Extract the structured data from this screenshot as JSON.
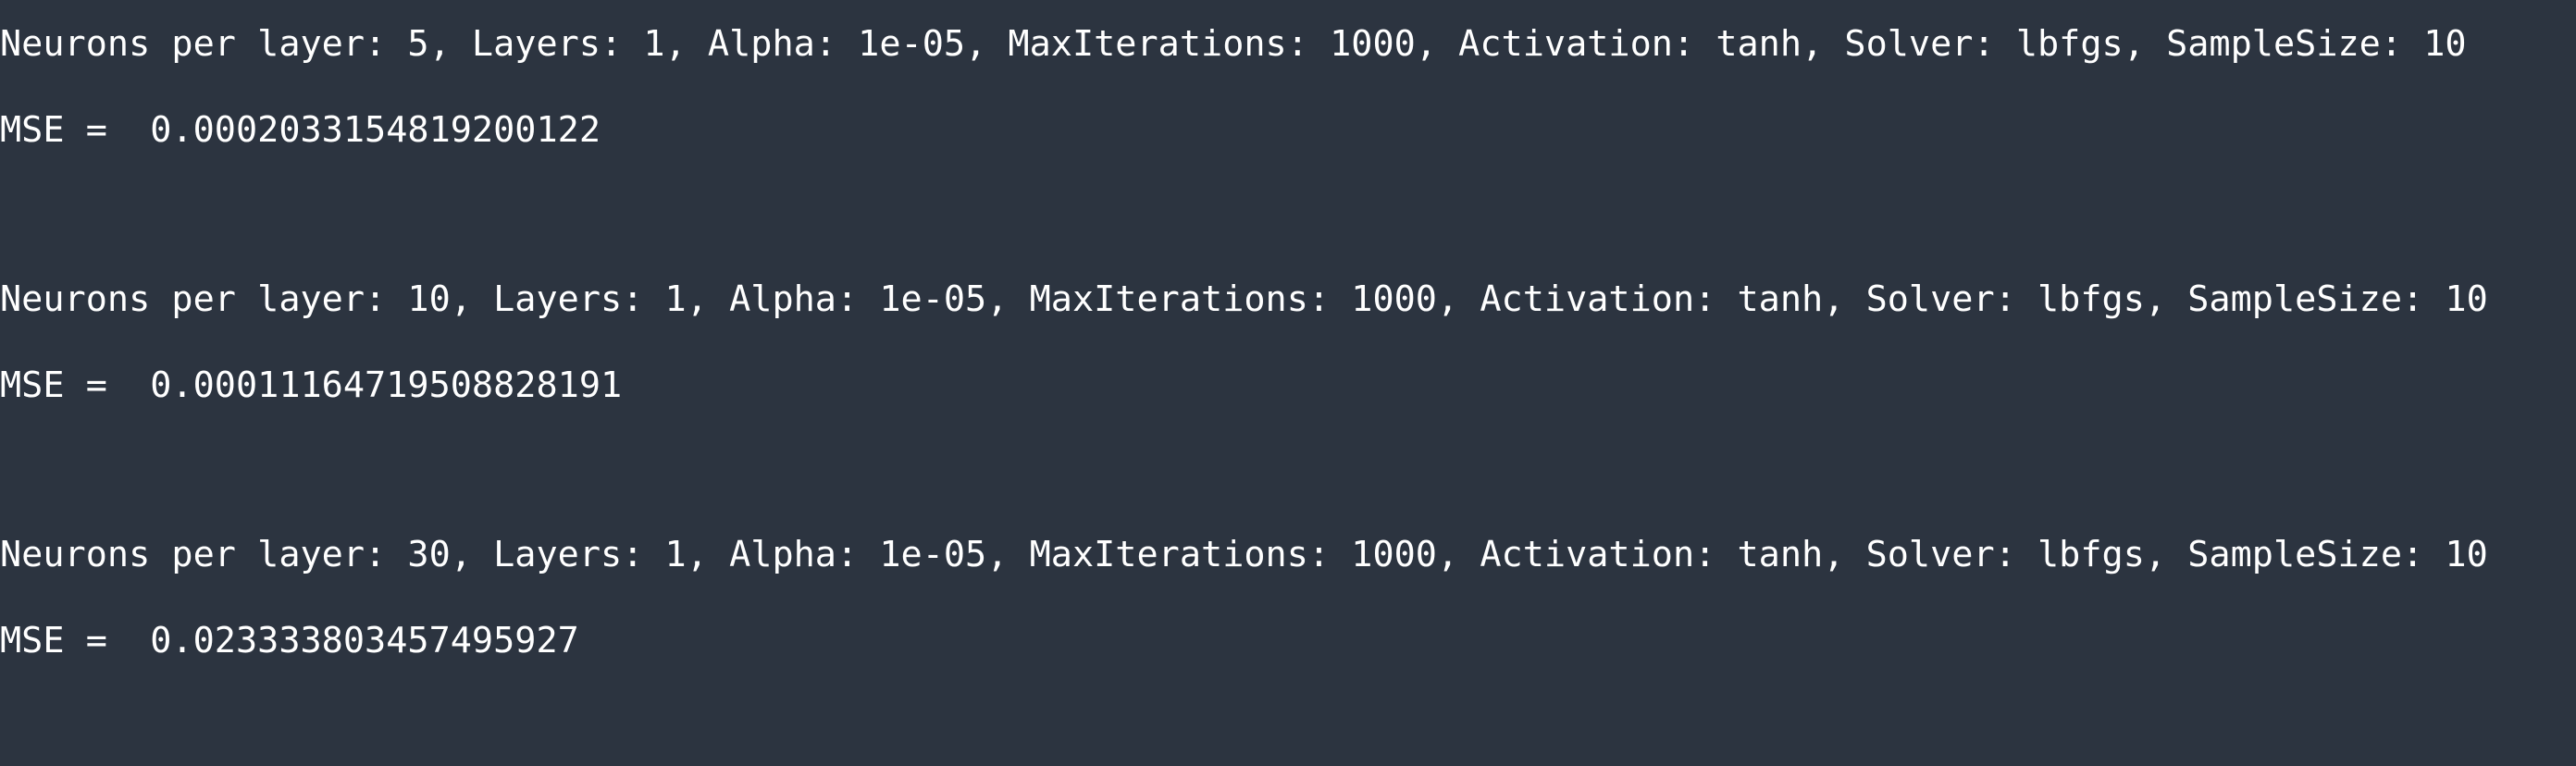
{
  "colors": {
    "background": "#2c3440",
    "text": "#ffffff"
  },
  "runs": [
    {
      "params": "Neurons per layer: 5, Layers: 1, Alpha: 1e-05, MaxIterations: 1000, Activation: tanh, Solver: lbfgs, SampleSize: 10",
      "mse": "MSE =  0.0002033154819200122"
    },
    {
      "params": "Neurons per layer: 10, Layers: 1, Alpha: 1e-05, MaxIterations: 1000, Activation: tanh, Solver: lbfgs, SampleSize: 10",
      "mse": "MSE =  0.00011164719508828191"
    },
    {
      "params": "Neurons per layer: 30, Layers: 1, Alpha: 1e-05, MaxIterations: 1000, Activation: tanh, Solver: lbfgs, SampleSize: 10",
      "mse": "MSE =  0.023333803457495927"
    }
  ]
}
